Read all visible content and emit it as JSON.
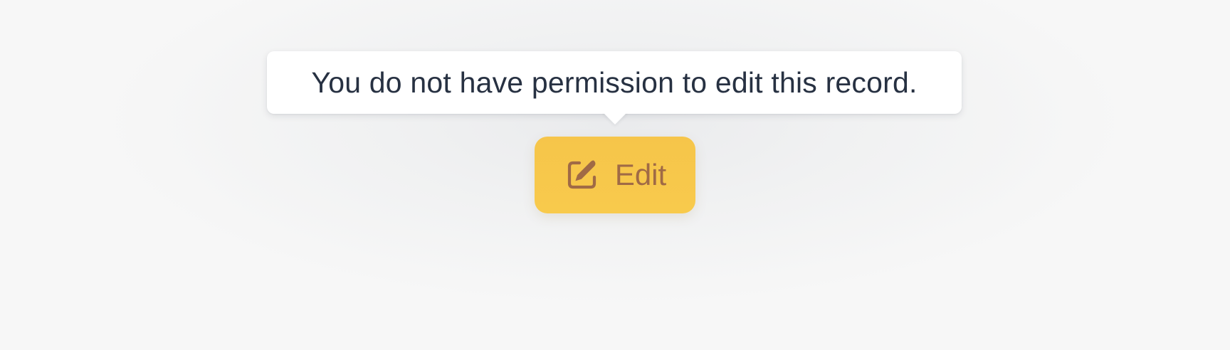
{
  "tooltip": {
    "message": "You do not have permission to edit this record."
  },
  "edit_button": {
    "label": "Edit",
    "icon": "edit-icon",
    "state": "disabled"
  },
  "colors": {
    "page_background": "#f7f7f7",
    "tooltip_background": "#ffffff",
    "tooltip_text": "#273142",
    "button_background": "#f8ca4c",
    "button_text": "#a06a45"
  }
}
